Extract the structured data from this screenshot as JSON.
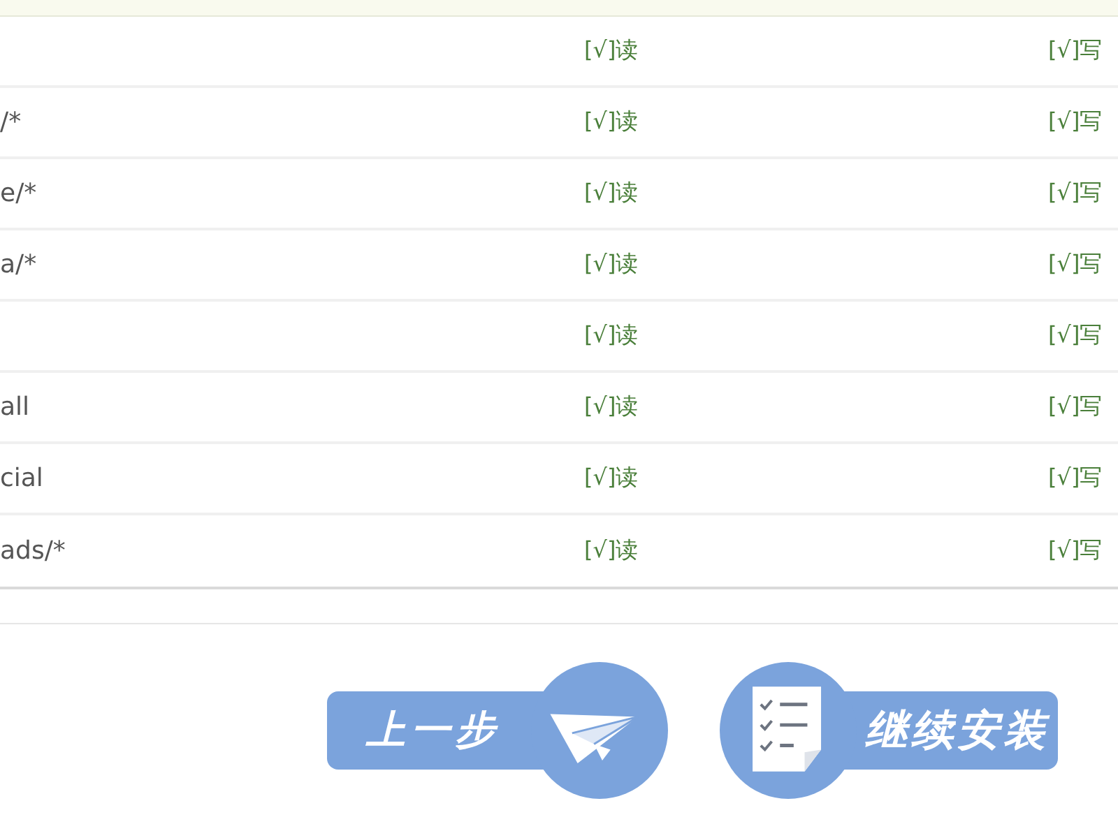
{
  "table": {
    "rows": [
      {
        "read": "[√]读",
        "write": "[√]写"
      },
      {
        "path": "/*",
        "read": "[√]读",
        "write": "[√]写"
      },
      {
        "path": "e/*",
        "read": "[√]读",
        "write": "[√]写"
      },
      {
        "path": "a/*",
        "read": "[√]读",
        "write": "[√]写"
      },
      {
        "read": "[√]读",
        "write": "[√]写"
      },
      {
        "path": "all",
        "read": "[√]读",
        "write": "[√]写"
      },
      {
        "path": "cial",
        "read": "[√]读",
        "write": "[√]写"
      },
      {
        "path": "ads/*",
        "read": "[√]读",
        "write": "[√]写"
      }
    ]
  },
  "buttons": [
    {
      "kind": "back",
      "label": "上一步"
    },
    {
      "kind": "continue",
      "label": "继续安装"
    }
  ]
}
